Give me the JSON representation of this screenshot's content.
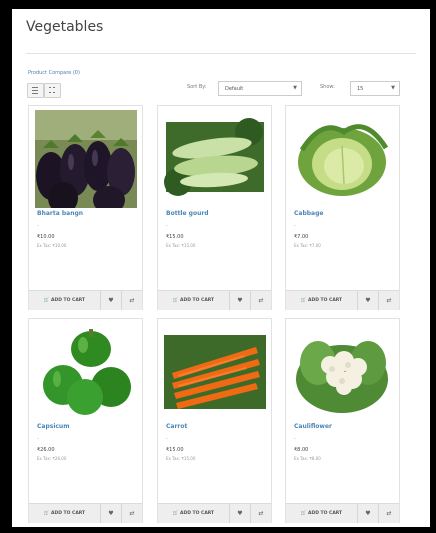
{
  "page": {
    "title": "Vegetables"
  },
  "toolbar": {
    "compare_link": "Product Compare (0)",
    "sort_label": "Sort By:",
    "sort_value": "Default",
    "show_label": "Show:",
    "show_value": "15"
  },
  "actions": {
    "add_to_cart": "ADD TO CART"
  },
  "products": [
    {
      "name": "Bharta bangn",
      "dash": "-",
      "price": "₹10.00",
      "extax": "Ex Tax: ₹10.00"
    },
    {
      "name": "Bottle gourd",
      "dash": "-",
      "price": "₹15.00",
      "extax": "Ex Tax: ₹15.00"
    },
    {
      "name": "Cabbage",
      "dash": "-",
      "price": "₹7.00",
      "extax": "Ex Tax: ₹7.00"
    },
    {
      "name": "Capsicum",
      "dash": "-",
      "price": "₹26.00",
      "extax": "Ex Tax: ₹26.00"
    },
    {
      "name": "Carrot",
      "dash": "-",
      "price": "₹15.00",
      "extax": "Ex Tax: ₹15.00"
    },
    {
      "name": "Cauliflower",
      "dash": "-",
      "price": "₹8.00",
      "extax": "Ex Tax: ₹8.00"
    }
  ]
}
